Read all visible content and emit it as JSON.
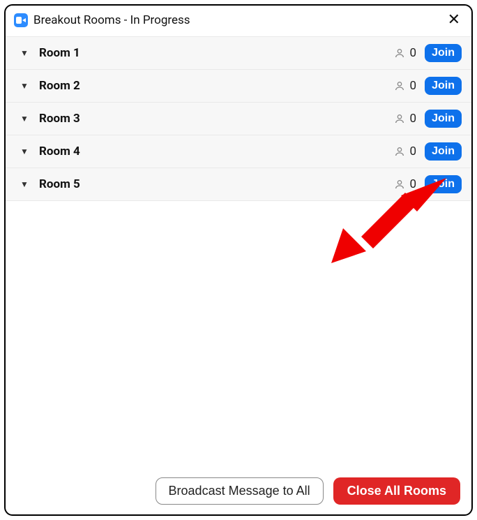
{
  "window": {
    "title": "Breakout Rooms - In Progress"
  },
  "rooms": [
    {
      "name": "Room 1",
      "count": "0",
      "join": "Join"
    },
    {
      "name": "Room 2",
      "count": "0",
      "join": "Join"
    },
    {
      "name": "Room 3",
      "count": "0",
      "join": "Join"
    },
    {
      "name": "Room 4",
      "count": "0",
      "join": "Join"
    },
    {
      "name": "Room 5",
      "count": "0",
      "join": "Join"
    }
  ],
  "footer": {
    "broadcast": "Broadcast Message to All",
    "closeAll": "Close All Rooms"
  }
}
